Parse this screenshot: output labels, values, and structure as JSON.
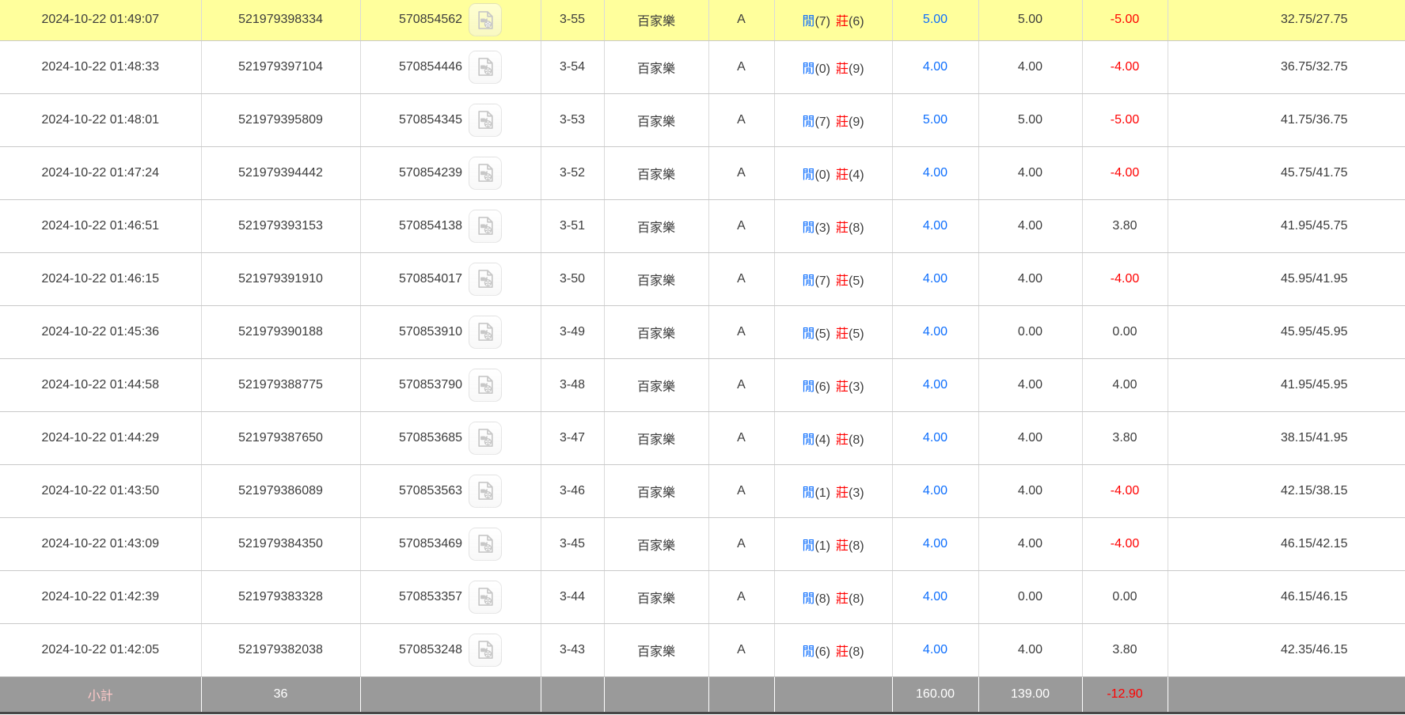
{
  "colors": {
    "highlight": "#ffff9c",
    "accent_blue": "#0d6efd",
    "neg_red": "#ff0000",
    "summary_bg": "#9a9a9a",
    "summary_label": "#ffc9c9",
    "text": "#3c3c3c"
  },
  "icons": {
    "video_button": "video-replay-icon"
  },
  "labels": {
    "player": "閒",
    "banker": "莊"
  },
  "rows": [
    {
      "time": "2024-10-22 01:49:07",
      "bet_id": "521979398334",
      "game_id": "570854562",
      "round": "3-55",
      "game": "百家樂",
      "table": "A",
      "player_score": "(7)",
      "banker_score": "(6)",
      "bet": "5.00",
      "valid": "5.00",
      "winloss": "-5.00",
      "balance": "32.75/27.75",
      "highlight": true
    },
    {
      "time": "2024-10-22 01:48:33",
      "bet_id": "521979397104",
      "game_id": "570854446",
      "round": "3-54",
      "game": "百家樂",
      "table": "A",
      "player_score": "(0)",
      "banker_score": "(9)",
      "bet": "4.00",
      "valid": "4.00",
      "winloss": "-4.00",
      "balance": "36.75/32.75",
      "highlight": false
    },
    {
      "time": "2024-10-22 01:48:01",
      "bet_id": "521979395809",
      "game_id": "570854345",
      "round": "3-53",
      "game": "百家樂",
      "table": "A",
      "player_score": "(7)",
      "banker_score": "(9)",
      "bet": "5.00",
      "valid": "5.00",
      "winloss": "-5.00",
      "balance": "41.75/36.75",
      "highlight": false
    },
    {
      "time": "2024-10-22 01:47:24",
      "bet_id": "521979394442",
      "game_id": "570854239",
      "round": "3-52",
      "game": "百家樂",
      "table": "A",
      "player_score": "(0)",
      "banker_score": "(4)",
      "bet": "4.00",
      "valid": "4.00",
      "winloss": "-4.00",
      "balance": "45.75/41.75",
      "highlight": false
    },
    {
      "time": "2024-10-22 01:46:51",
      "bet_id": "521979393153",
      "game_id": "570854138",
      "round": "3-51",
      "game": "百家樂",
      "table": "A",
      "player_score": "(3)",
      "banker_score": "(8)",
      "bet": "4.00",
      "valid": "4.00",
      "winloss": "3.80",
      "balance": "41.95/45.75",
      "highlight": false
    },
    {
      "time": "2024-10-22 01:46:15",
      "bet_id": "521979391910",
      "game_id": "570854017",
      "round": "3-50",
      "game": "百家樂",
      "table": "A",
      "player_score": "(7)",
      "banker_score": "(5)",
      "bet": "4.00",
      "valid": "4.00",
      "winloss": "-4.00",
      "balance": "45.95/41.95",
      "highlight": false
    },
    {
      "time": "2024-10-22 01:45:36",
      "bet_id": "521979390188",
      "game_id": "570853910",
      "round": "3-49",
      "game": "百家樂",
      "table": "A",
      "player_score": "(5)",
      "banker_score": "(5)",
      "bet": "4.00",
      "valid": "0.00",
      "winloss": "0.00",
      "balance": "45.95/45.95",
      "highlight": false
    },
    {
      "time": "2024-10-22 01:44:58",
      "bet_id": "521979388775",
      "game_id": "570853790",
      "round": "3-48",
      "game": "百家樂",
      "table": "A",
      "player_score": "(6)",
      "banker_score": "(3)",
      "bet": "4.00",
      "valid": "4.00",
      "winloss": "4.00",
      "balance": "41.95/45.95",
      "highlight": false
    },
    {
      "time": "2024-10-22 01:44:29",
      "bet_id": "521979387650",
      "game_id": "570853685",
      "round": "3-47",
      "game": "百家樂",
      "table": "A",
      "player_score": "(4)",
      "banker_score": "(8)",
      "bet": "4.00",
      "valid": "4.00",
      "winloss": "3.80",
      "balance": "38.15/41.95",
      "highlight": false
    },
    {
      "time": "2024-10-22 01:43:50",
      "bet_id": "521979386089",
      "game_id": "570853563",
      "round": "3-46",
      "game": "百家樂",
      "table": "A",
      "player_score": "(1)",
      "banker_score": "(3)",
      "bet": "4.00",
      "valid": "4.00",
      "winloss": "-4.00",
      "balance": "42.15/38.15",
      "highlight": false
    },
    {
      "time": "2024-10-22 01:43:09",
      "bet_id": "521979384350",
      "game_id": "570853469",
      "round": "3-45",
      "game": "百家樂",
      "table": "A",
      "player_score": "(1)",
      "banker_score": "(8)",
      "bet": "4.00",
      "valid": "4.00",
      "winloss": "-4.00",
      "balance": "46.15/42.15",
      "highlight": false
    },
    {
      "time": "2024-10-22 01:42:39",
      "bet_id": "521979383328",
      "game_id": "570853357",
      "round": "3-44",
      "game": "百家樂",
      "table": "A",
      "player_score": "(8)",
      "banker_score": "(8)",
      "bet": "4.00",
      "valid": "0.00",
      "winloss": "0.00",
      "balance": "46.15/46.15",
      "highlight": false
    },
    {
      "time": "2024-10-22 01:42:05",
      "bet_id": "521979382038",
      "game_id": "570853248",
      "round": "3-43",
      "game": "百家樂",
      "table": "A",
      "player_score": "(6)",
      "banker_score": "(8)",
      "bet": "4.00",
      "valid": "4.00",
      "winloss": "3.80",
      "balance": "42.35/46.15",
      "highlight": false
    }
  ],
  "summary": {
    "label": "小計",
    "count": "36",
    "bet_total": "160.00",
    "valid_total": "139.00",
    "winloss_total": "-12.90"
  }
}
